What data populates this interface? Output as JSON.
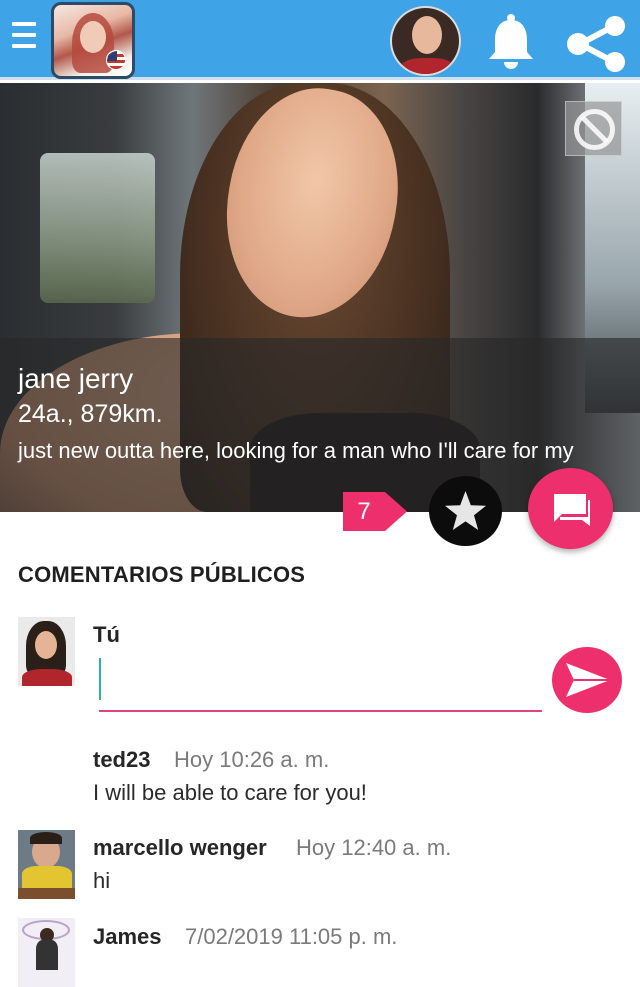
{
  "header": {
    "menu_icon": "hamburger-menu-icon",
    "logo_icon": "app-logo-icon",
    "avatar_icon": "user-avatar",
    "bell_icon": "bell-icon",
    "share_icon": "share-icon",
    "bar_color": "#3fa3e8"
  },
  "profile": {
    "name": "jane jerry",
    "meta": "24a., 879km.",
    "bio": "just new outta here, looking for a man who I'll care for my",
    "block_icon": "block-icon"
  },
  "actions": {
    "count_badge": "7",
    "favorite_icon": "star-icon",
    "chat_icon": "chat-bubbles-icon",
    "accent_color": "#ee2f6e"
  },
  "comments": {
    "section_title": "COMENTARIOS PÚBLICOS",
    "composer": {
      "author": "Tú",
      "value": "",
      "placeholder": "",
      "send_icon": "send-icon"
    },
    "items": [
      {
        "author": "ted23",
        "time": "Hoy 10:26 a. m.",
        "text": "I will be able to care for you!"
      },
      {
        "author": "marcello wenger",
        "time": "Hoy 12:40 a. m.",
        "text": "hi"
      },
      {
        "author": "James",
        "time": "7/02/2019 11:05 p. m.",
        "text": ""
      }
    ]
  }
}
